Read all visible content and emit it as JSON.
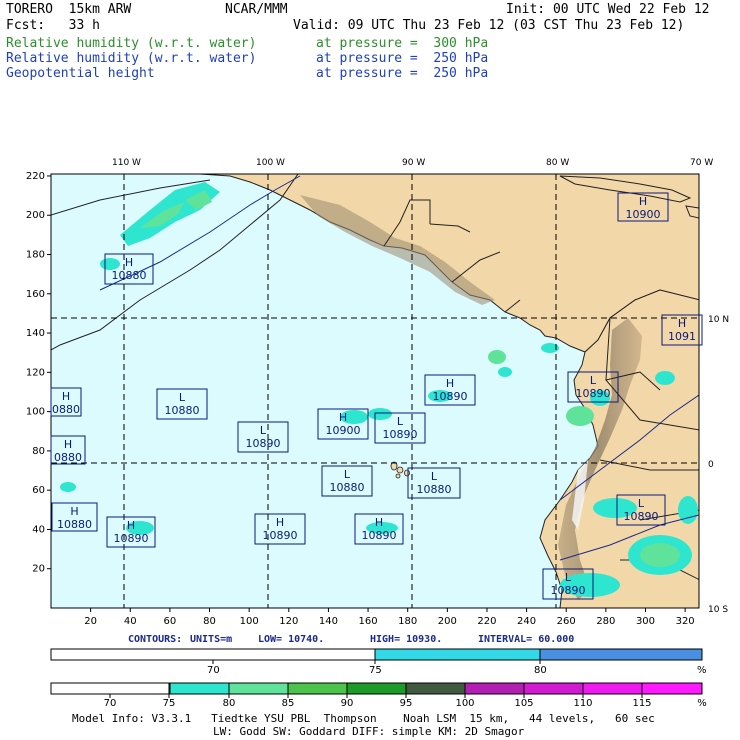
{
  "header": {
    "line1_left": "TORERO  15km ARW",
    "line1_mid": "NCAR/MMM",
    "line1_right": "Init: 00 UTC Wed 22 Feb 12",
    "line2_left": "Fcst:   33 h",
    "line2_right": "Valid: 09 UTC Thu 23 Feb 12 (03 CST Thu 23 Feb 12)",
    "fields": [
      {
        "name": "Relative humidity (w.r.t. water)",
        "level": "at pressure =  300 hPa",
        "color": "#2a8f2a"
      },
      {
        "name": "Relative humidity (w.r.t. water)",
        "level": "at pressure =  250 hPa",
        "color": "#1f3fbf"
      },
      {
        "name": "Geopotential height",
        "level": "at pressure =  250 hPa",
        "color": "#1f3fbf"
      }
    ]
  },
  "map": {
    "lon_labels": [
      "110 W",
      "100 W",
      "90 W",
      "80 W",
      "70 W"
    ],
    "lat_labels": [
      "10 N",
      "0",
      "10 S"
    ],
    "x_ticks": [
      "20",
      "40",
      "60",
      "80",
      "100",
      "120",
      "140",
      "160",
      "180",
      "200",
      "220",
      "240",
      "260",
      "280",
      "300",
      "320"
    ],
    "y_ticks": [
      "20",
      "40",
      "60",
      "80",
      "100",
      "120",
      "140",
      "160",
      "180",
      "200",
      "220"
    ],
    "centers": [
      {
        "type": "H",
        "value": "10880"
      },
      {
        "type": "H",
        "value": "10900"
      },
      {
        "type": "H",
        "value": "0880"
      },
      {
        "type": "H",
        "value": "0880"
      },
      {
        "type": "H",
        "value": "10880"
      },
      {
        "type": "H",
        "value": "10890"
      },
      {
        "type": "L",
        "value": "10880"
      },
      {
        "type": "L",
        "value": "10890"
      },
      {
        "type": "H",
        "value": "10900"
      },
      {
        "type": "L",
        "value": "10890"
      },
      {
        "type": "H",
        "value": "10890"
      },
      {
        "type": "L",
        "value": "10880"
      },
      {
        "type": "L",
        "value": "10880"
      },
      {
        "type": "H",
        "value": "10890"
      },
      {
        "type": "H",
        "value": "10890"
      },
      {
        "type": "L",
        "value": "10890"
      },
      {
        "type": "L",
        "value": "10890"
      },
      {
        "type": "L",
        "value": "10890"
      },
      {
        "type": "H",
        "value": "1091"
      }
    ]
  },
  "contours_line": {
    "label": "CONTOURS:",
    "units": "UNITS=m",
    "low": "LOW= 10740.",
    "high": "HIGH= 10930.",
    "interval": "INTERVAL= 60.000"
  },
  "colorbar_300": {
    "labels": [
      "70",
      "75",
      "80",
      "%"
    ],
    "colors": [
      "#ffffff",
      "#ffffff",
      "#33d9e6",
      "#4a90e2"
    ]
  },
  "colorbar_250": {
    "labels": [
      "70",
      "75",
      "80",
      "85",
      "90",
      "95",
      "100",
      "105",
      "110",
      "115",
      "%"
    ],
    "colors": [
      "#ffffff",
      "#ffffff",
      "#2ee6cf",
      "#5fe39a",
      "#4cc44c",
      "#1e9a2a",
      "#3f5a3f",
      "#b31fb3",
      "#d11ad1",
      "#ef1aef",
      "#ff1aff"
    ]
  },
  "footer": {
    "line1": "Model Info: V3.3.1   Tiedtke YSU PBL  Thompson    Noah LSM  15 km,   44 levels,   60 sec",
    "line2": "LW: Godd SW: Goddard DIFF: simple KM: 2D Smagor"
  }
}
